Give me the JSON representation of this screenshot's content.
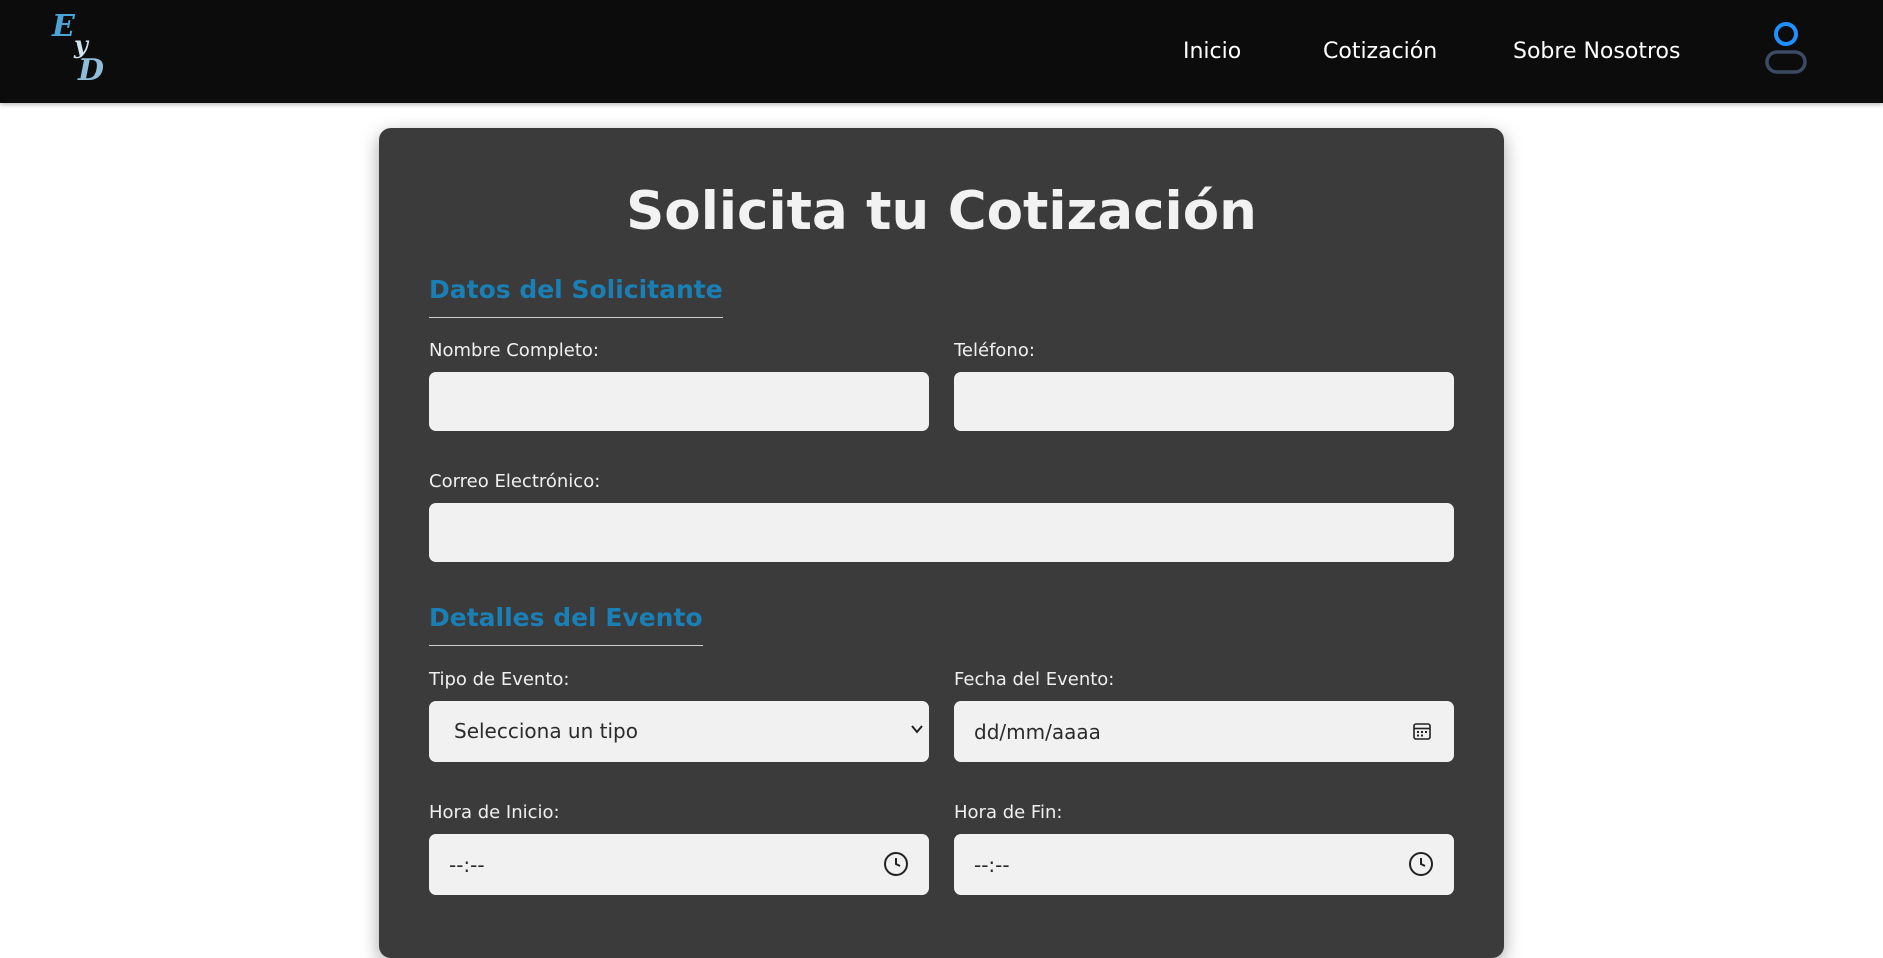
{
  "nav": {
    "logo_letters": [
      "E",
      "y",
      "D"
    ],
    "links": [
      "Inicio",
      "Cotización",
      "Sobre Nosotros"
    ]
  },
  "form": {
    "title": "Solicita tu Cotización",
    "sections": {
      "solicitante": {
        "title": "Datos del Solicitante",
        "fields": {
          "nombre": {
            "label": "Nombre Completo:",
            "value": ""
          },
          "telefono": {
            "label": "Teléfono:",
            "value": ""
          },
          "correo": {
            "label": "Correo Electrónico:",
            "value": ""
          }
        }
      },
      "evento": {
        "title": "Detalles del Evento",
        "fields": {
          "tipo": {
            "label": "Tipo de Evento:",
            "value": "Selecciona un tipo"
          },
          "fecha": {
            "label": "Fecha del Evento:",
            "value": "dd/mm/aaaa"
          },
          "hora_inicio": {
            "label": "Hora de Inicio:",
            "value": "--:--"
          },
          "hora_fin": {
            "label": "Hora de Fin:",
            "value": "--:--"
          }
        }
      }
    }
  },
  "colors": {
    "navbar": "#0c0c0c",
    "card": "#3b3b3b",
    "section_accent": "#1a7fb5",
    "input_bg": "#f1f1f1",
    "user_icon_head": "#1e90ff",
    "user_icon_body": "#3c4a63"
  },
  "icons": {
    "user": "user-icon",
    "calendar": "calendar-icon",
    "clock": "clock-icon",
    "dropdown": "chevron-down-icon"
  }
}
